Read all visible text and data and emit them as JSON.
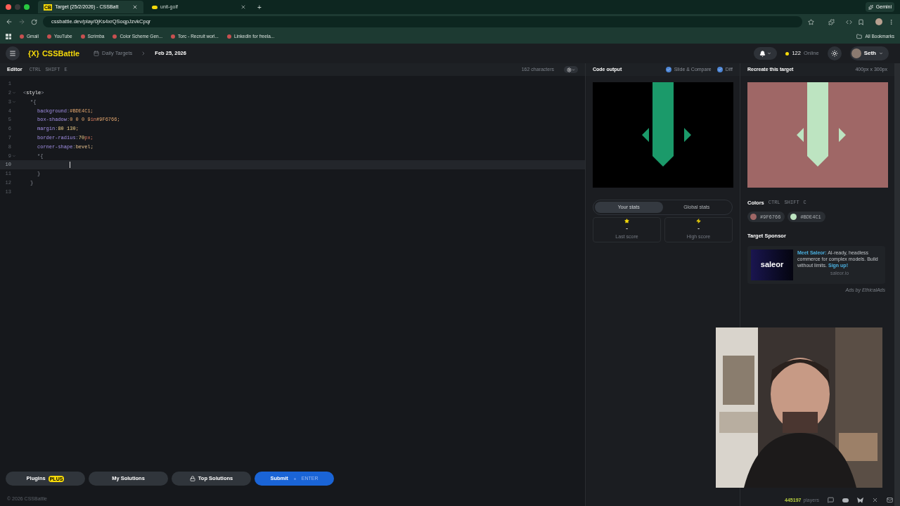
{
  "browser": {
    "tabs": [
      {
        "title": "Target (25/2/2026) - CSSBatt",
        "selected": true,
        "favicon": "CB"
      },
      {
        "title": "unit-golf",
        "selected": false
      }
    ],
    "new_tab": "+",
    "gemini": "Gemini",
    "url": "cssbattle.dev/play/0jKs4xrQSoqpJzvkCpqr",
    "bookmarks": [
      "Gmail",
      "YouTube",
      "Scrimba",
      "Color Scheme Gen...",
      "Torc - Recruit worl...",
      "LinkedIn for freela..."
    ],
    "all_bookmarks": "All Bookmarks"
  },
  "header": {
    "logo_mark": "{X}",
    "logo_text": "CSSBattle",
    "breadcrumb": "Daily Targets",
    "date": "Feb 25, 2026",
    "online_count": "122",
    "online_label": "Online",
    "user": "Seth"
  },
  "editor": {
    "title": "Editor",
    "shortcut": [
      "CTRL",
      "SHIFT",
      "E"
    ],
    "char_count": "162 characters",
    "lines": [
      {
        "number": "1",
        "kind": "top",
        "fold": false,
        "current": false
      },
      {
        "number": "2",
        "kind": "top",
        "fold": true,
        "current": false,
        "tokens": [
          {
            "kind": "punct",
            "text": "<"
          },
          {
            "kind": "tag",
            "text": "style"
          },
          {
            "kind": "punct",
            "text": ">"
          }
        ]
      },
      {
        "number": "3",
        "kind": "rule",
        "fold": true,
        "current": false,
        "tokens": [
          {
            "kind": "punct",
            "text": "*{"
          }
        ]
      },
      {
        "number": "4",
        "kind": "decl",
        "fold": false,
        "current": false,
        "tokens": [
          {
            "kind": "prop",
            "text": "background"
          },
          {
            "kind": "punct",
            "text": ":"
          },
          {
            "kind": "value",
            "text": "#BDE4C1;"
          }
        ]
      },
      {
        "number": "5",
        "kind": "decl",
        "fold": false,
        "current": false,
        "tokens": [
          {
            "kind": "prop",
            "text": "box-shadow"
          },
          {
            "kind": "punct",
            "text": ":"
          },
          {
            "kind": "value",
            "text": "0 0 0 9"
          },
          {
            "kind": "unit",
            "text": "in"
          },
          {
            "kind": "value",
            "text": "#9F6766;"
          }
        ]
      },
      {
        "number": "6",
        "kind": "decl",
        "fold": false,
        "current": false,
        "tokens": [
          {
            "kind": "prop",
            "text": "margin"
          },
          {
            "kind": "punct",
            "text": ":"
          },
          {
            "kind": "number",
            "text": "80 130"
          },
          {
            "kind": "value",
            "text": ";"
          }
        ]
      },
      {
        "number": "7",
        "kind": "decl",
        "fold": false,
        "current": false,
        "tokens": [
          {
            "kind": "prop",
            "text": "border-radius"
          },
          {
            "kind": "punct",
            "text": ":"
          },
          {
            "kind": "number",
            "text": "70"
          },
          {
            "kind": "unit",
            "text": "px;"
          }
        ]
      },
      {
        "number": "8",
        "kind": "decl",
        "fold": false,
        "current": false,
        "tokens": [
          {
            "kind": "prop",
            "text": "corner-shape"
          },
          {
            "kind": "punct",
            "text": ":"
          },
          {
            "kind": "keyword",
            "text": "bevel;"
          }
        ]
      },
      {
        "number": "9",
        "kind": "decl",
        "fold": true,
        "current": false,
        "tokens": [
          {
            "kind": "punct",
            "text": "*{"
          }
        ]
      },
      {
        "number": "10",
        "kind": "decl",
        "fold": false,
        "current": true
      },
      {
        "number": "11",
        "kind": "decl",
        "fold": false,
        "current": false,
        "tokens": [
          {
            "kind": "punct",
            "text": "}"
          }
        ]
      },
      {
        "number": "12",
        "kind": "rule",
        "fold": false,
        "current": false,
        "tokens": [
          {
            "kind": "punct",
            "text": "}"
          }
        ]
      },
      {
        "number": "13",
        "kind": "top",
        "fold": false,
        "current": false
      }
    ]
  },
  "output": {
    "title": "Code output",
    "slide_compare": {
      "label": "Slide & Compare",
      "checked": true
    },
    "diff": {
      "label": "Diff",
      "checked": true
    },
    "stats_tabs": [
      {
        "label": "Your stats",
        "selected": true
      },
      {
        "label": "Global stats",
        "selected": false
      }
    ],
    "stats": [
      {
        "kind": "star",
        "value": "-",
        "label": "Last score"
      },
      {
        "kind": "bolt",
        "value": "-",
        "label": "High score"
      }
    ]
  },
  "target": {
    "title": "Recreate this target",
    "size": "400px x 300px",
    "colors_title": "Colors",
    "colors_shortcut": [
      "CTRL",
      "SHIFT",
      "C"
    ],
    "colors": [
      {
        "label": "#9F6766",
        "color": "#9f6766"
      },
      {
        "label": "#BDE4C1",
        "color": "#bde4c1"
      }
    ],
    "sponsor_title": "Target Sponsor",
    "sponsor_logo": "saleor",
    "sponsor_lead": "Meet Saleor:",
    "sponsor_text": "AI-ready, headless commerce for complex models. Build without limits.",
    "sponsor_link": "Sign up!",
    "sponsor_domain": "saleor.io",
    "ads_by": "Ads by EthicalAds"
  },
  "actions": [
    {
      "kind": "plugins",
      "label": "Plugins",
      "badge": "PLUS"
    },
    {
      "kind": "plain",
      "label": "My Solutions"
    },
    {
      "kind": "locked",
      "label": "Top Solutions"
    },
    {
      "kind": "submit",
      "label": "Submit",
      "hint": "ENTER"
    }
  ],
  "footer": {
    "copyright": "© 2026 CSSBattle",
    "players_count": "445197",
    "players_label": "players"
  }
}
